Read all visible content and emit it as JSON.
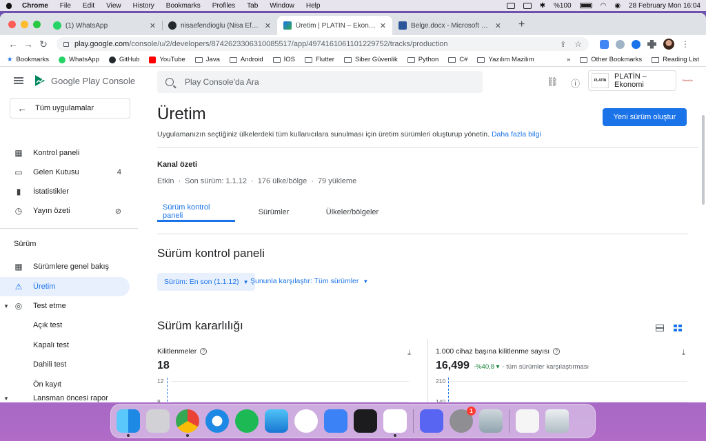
{
  "menubar": {
    "app": "Chrome",
    "menus": [
      "File",
      "Edit",
      "View",
      "History",
      "Bookmarks",
      "Profiles",
      "Tab",
      "Window",
      "Help"
    ],
    "battery": "%100",
    "datetime": "28 February Mon  16:04"
  },
  "tabs": [
    {
      "title": "(1) WhatsApp",
      "color": "#25d366"
    },
    {
      "title": "nisaefendioglu (Nisa Efendioğl",
      "color": "#24292e"
    },
    {
      "title": "Üretim | PLATİN – Ekonomi",
      "color": "#1a73e8"
    },
    {
      "title": "Belge.docx - Microsoft Word O",
      "color": "#2b579a"
    }
  ],
  "url": {
    "host": "play.google.com",
    "path": "/console/u/2/developers/8742623306310085517/app/4974161061101229752/tracks/production"
  },
  "bookmarks": {
    "items": [
      "Bookmarks",
      "WhatsApp",
      "GitHub",
      "YouTube",
      "Java",
      "Android",
      "İOS",
      "Flutter",
      "Siber Güvenlik",
      "Python",
      "C#",
      "Yazılım Mazilım"
    ],
    "more": "»",
    "other": "Other Bookmarks",
    "reading": "Reading List"
  },
  "console": {
    "brand": "Google Play Console",
    "search_placeholder": "Play Console'da Ara",
    "app_name": "PLATİN – Ekonomi",
    "app_logo_text": "PLATİN",
    "account_logo_text": "Sabahlık"
  },
  "sidebar": {
    "all_apps": "Tüm uygulamalar",
    "items": [
      {
        "label": "Kontrol paneli",
        "icon": "▦"
      },
      {
        "label": "Gelen Kutusu",
        "icon": "▭",
        "badge": "4"
      },
      {
        "label": "İstatistikler",
        "icon": "▮"
      },
      {
        "label": "Yayın özeti",
        "icon": "◷"
      }
    ],
    "section": "Sürüm",
    "release_items": [
      {
        "label": "Sürümlere genel bakış"
      },
      {
        "label": "Üretim"
      },
      {
        "label": "Test etme"
      },
      {
        "label": "Açık test"
      },
      {
        "label": "Kapalı test"
      },
      {
        "label": "Dahili test"
      },
      {
        "label": "Ön kayıt"
      },
      {
        "label": "Lansman öncesi rapor"
      }
    ]
  },
  "page": {
    "title": "Üretim",
    "description": "Uygulamanızın seçtiğiniz ülkelerdeki tüm kullanıcılara sunulması için üretim sürümleri oluşturup yönetin.",
    "learn_more": "Daha fazla bilgi",
    "new_release": "Yeni sürüm oluştur",
    "channel_title": "Kanal özeti",
    "channel_status": "Etkin",
    "channel_version": "Son sürüm: 1.1.12",
    "channel_countries": "176 ülke/bölge",
    "channel_installs": "79 yükleme",
    "tabs": [
      "Sürüm kontrol paneli",
      "Sürümler",
      "Ülkeler/bölgeler"
    ],
    "dashboard_title": "Sürüm kontrol paneli",
    "release_filter": "Sürüm: En son (1.1.12)",
    "compare_filter": "Şununla karşılaştır: Tüm sürümler",
    "stability_title": "Sürüm kararlılığı",
    "card1": {
      "label": "Kilitlenmeler",
      "value": "18",
      "ticks": [
        "12",
        "8"
      ]
    },
    "card2": {
      "label": "1.000 cihaz başına kilitlenme sayısı",
      "value": "16,499",
      "delta": "-%40,8",
      "note": "- tüm sürümler karşılaştırması",
      "ticks": [
        "210",
        "140"
      ]
    }
  }
}
